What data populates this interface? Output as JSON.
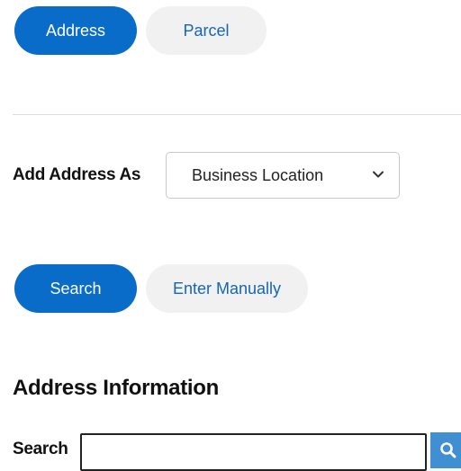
{
  "tabs": {
    "address_label": "Address",
    "parcel_label": "Parcel"
  },
  "add_address": {
    "label": "Add Address As",
    "selected_option": "Business Location"
  },
  "actions": {
    "search_label": "Search",
    "manual_label": "Enter Manually"
  },
  "address_info": {
    "title": "Address Information",
    "search_label": "Search",
    "search_value": ""
  },
  "colors": {
    "accent": "#0a6cc9",
    "inactive_pill_bg": "#f1f1f1",
    "inactive_pill_text": "#1566b6",
    "search_button": "#3f8fd2"
  },
  "icons": {
    "select_arrow": "chevron-down-icon",
    "search_button": "search-icon"
  }
}
